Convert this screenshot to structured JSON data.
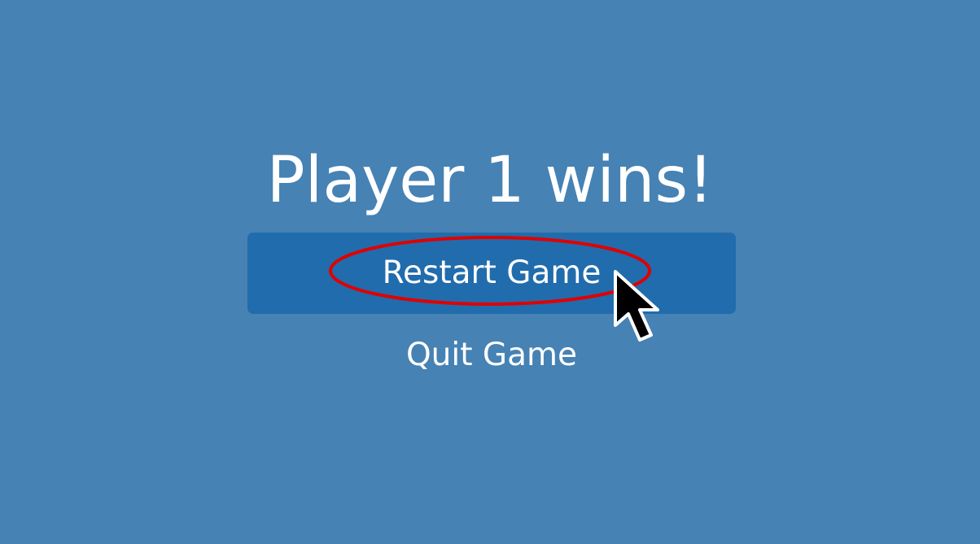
{
  "screen": {
    "title": "Player 1 wins!",
    "background_color": "#4682b4"
  },
  "menu": {
    "items": [
      {
        "label": "Restart Game",
        "selected": true
      },
      {
        "label": "Quit Game",
        "selected": false
      }
    ],
    "selected_color": "#216cac"
  },
  "overlay": {
    "highlight_color": "#e00000",
    "cursor_icon": "mouse-pointer-icon"
  }
}
